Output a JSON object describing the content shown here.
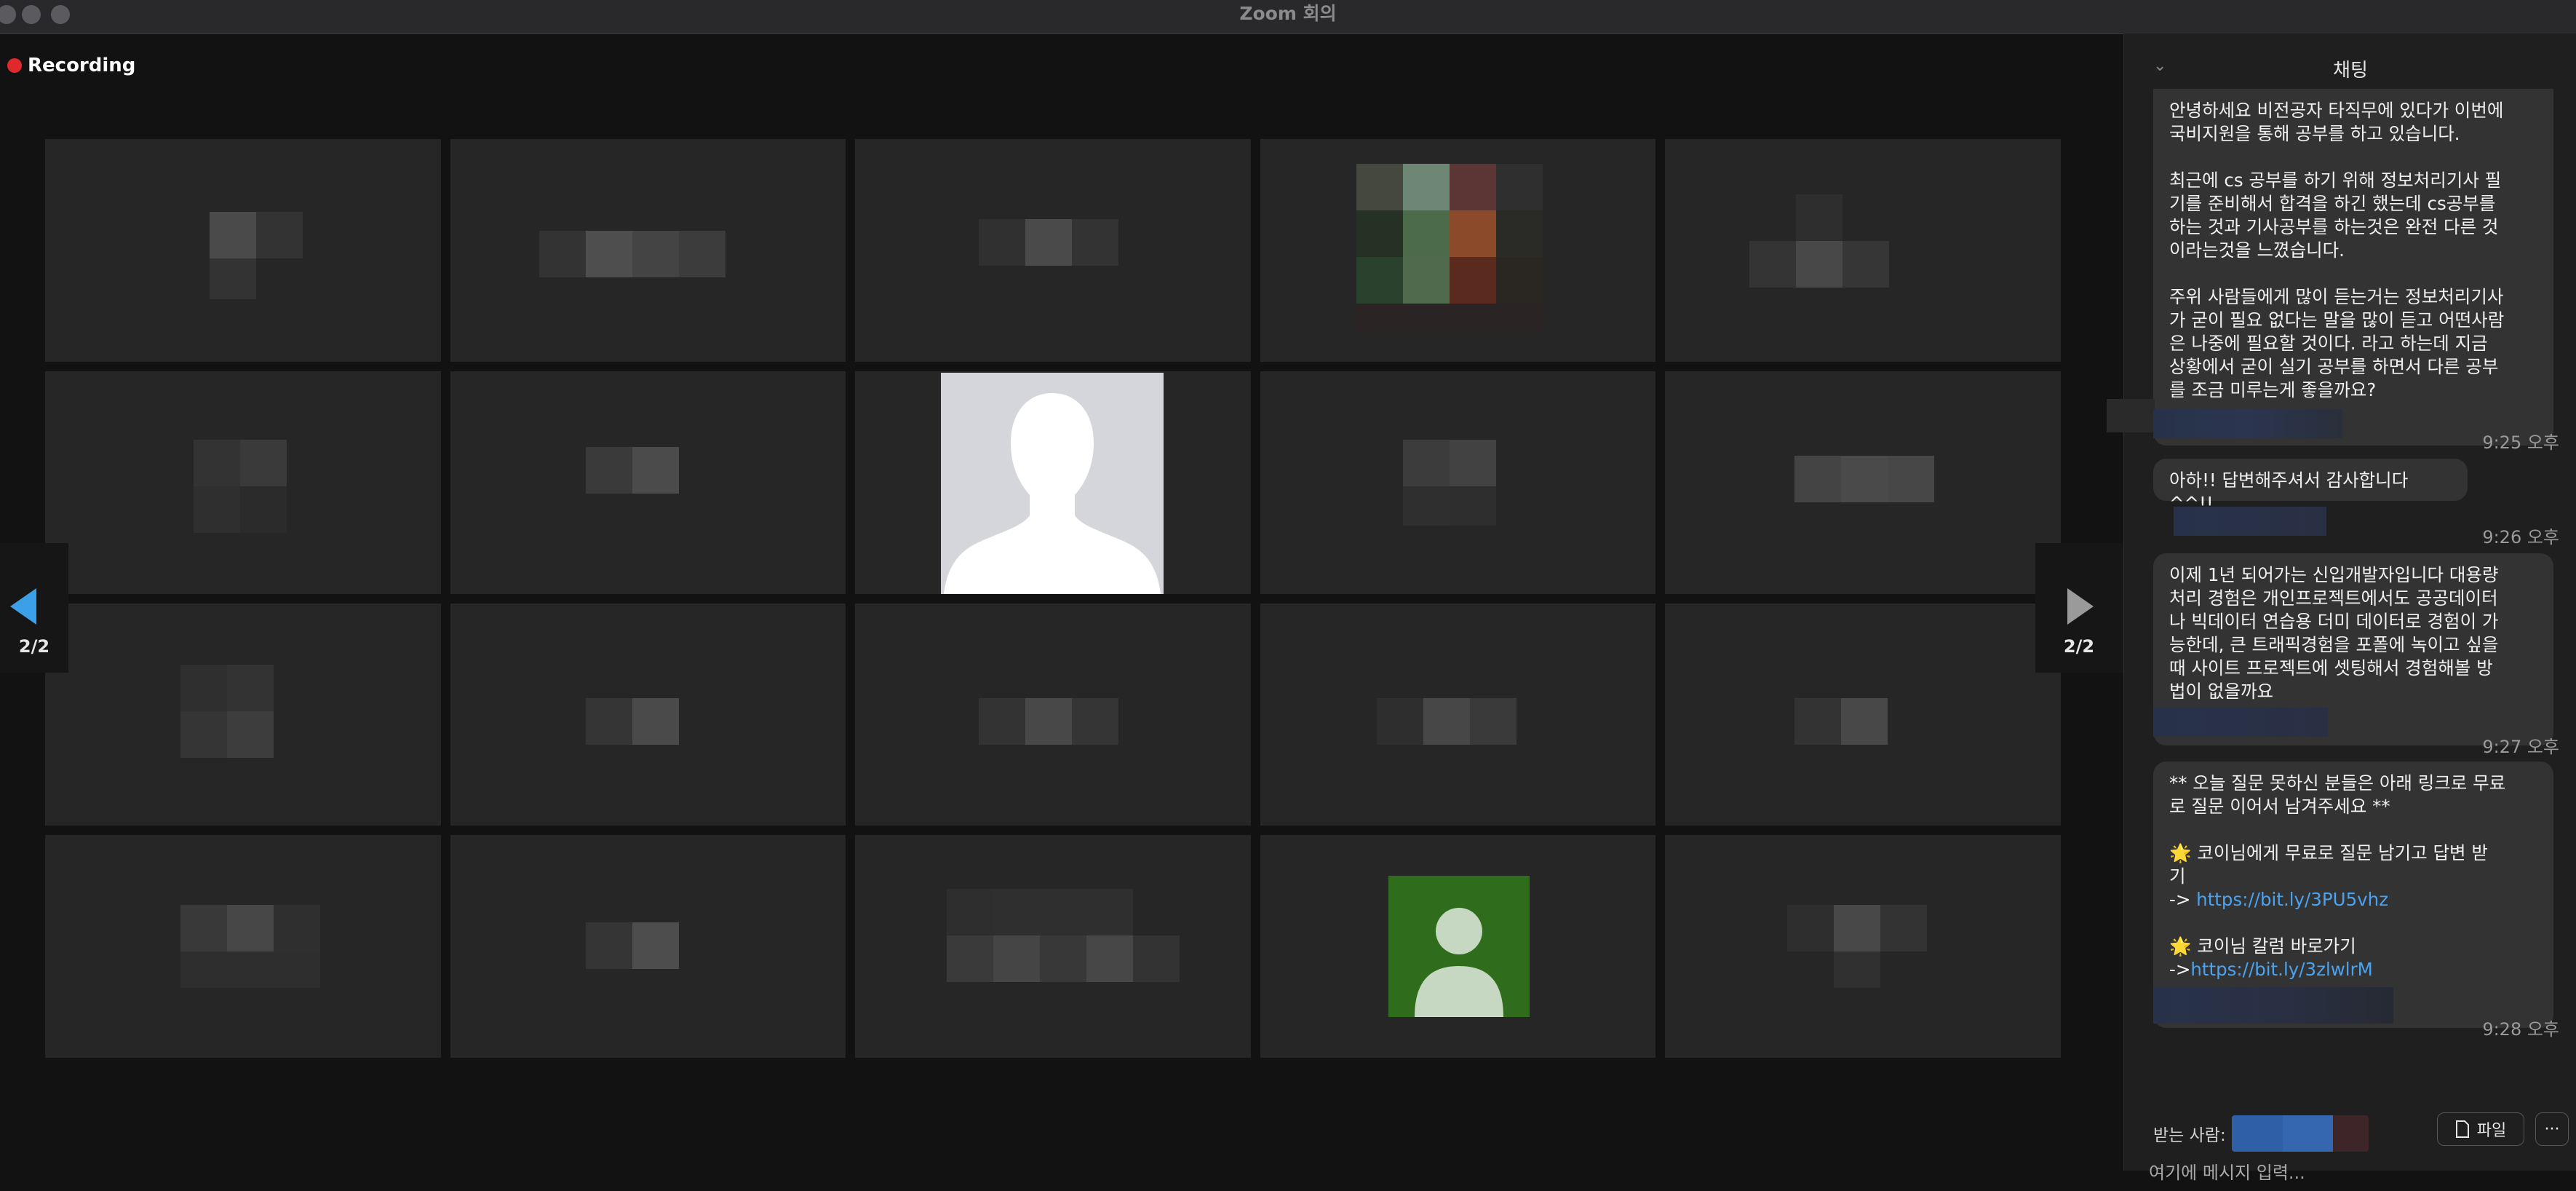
{
  "window": {
    "title": "Zoom 회의"
  },
  "recording": {
    "label": "Recording"
  },
  "pagination": {
    "left": "2/2",
    "right": "2/2"
  },
  "chat": {
    "title": "채팅",
    "messages": [
      {
        "text": "안녕하세요 비전공자 타직무에 있다가 이번에\n국비지원을 통해 공부를 하고 있습니다.\n\n최근에 cs 공부를 하기 위해 정보처리기사 필\n기를 준비해서 합격을 하긴 했는데 cs공부를\n하는 것과 기사공부를 하는것은 완전 다른 것\n이라는것을 느꼈습니다.\n\n주위 사람들에게 많이 듣는거는 정보처리기사\n가 굳이 필요 없다는 말을 많이 듣고 어떤사람\n은 나중에 필요할 것이다. 라고 하는데 지금\n상황에서 굳이 실기 공부를 하면서 다른 공부\n를 조금 미루는게 좋을까요?",
        "time": "9:25 오후"
      },
      {
        "text": "아하!! 답변해주셔서 감사합니다 ^^!!",
        "time": "9:26 오후"
      },
      {
        "text": "이제 1년 되어가는 신입개발자입니다 대용량\n처리 경험은 개인프로젝트에서도 공공데이터\n나 빅데이터 연습용 더미 데이터로 경험이 가\n능한데, 큰 트래픽경험을 포폴에 녹이고 싶을\n때 사이트 프로젝트에 셋팅해서 경험해볼 방\n법이 없을까요",
        "time": "9:27 오후"
      },
      {
        "line1": "** 오늘 질문 못하신 분들은 아래 링크로 무료\n로 질문 이어서 남겨주세요 **",
        "item1": "🌟 코이님에게 무료로 질문 남기고 답변 받\n기",
        "arrow1": "-> ",
        "link1": "https://bit.ly/3PU5vhz",
        "item2": "🌟 코이님 칼럼 바로가기",
        "arrow2": "->",
        "link2": "https://bit.ly/3zlwlrM",
        "time": "9:28 오후"
      }
    ],
    "recipient_label": "받는 사람:",
    "file_button": "파일",
    "more_button": "···",
    "input_placeholder": "여기에 메시지 입력..."
  },
  "colors": {
    "recording_dot": "#e0282d",
    "link": "#4aa3f0",
    "nav_arrow_active": "#3ca0e8",
    "avatar_green": "#2f6d1c"
  }
}
